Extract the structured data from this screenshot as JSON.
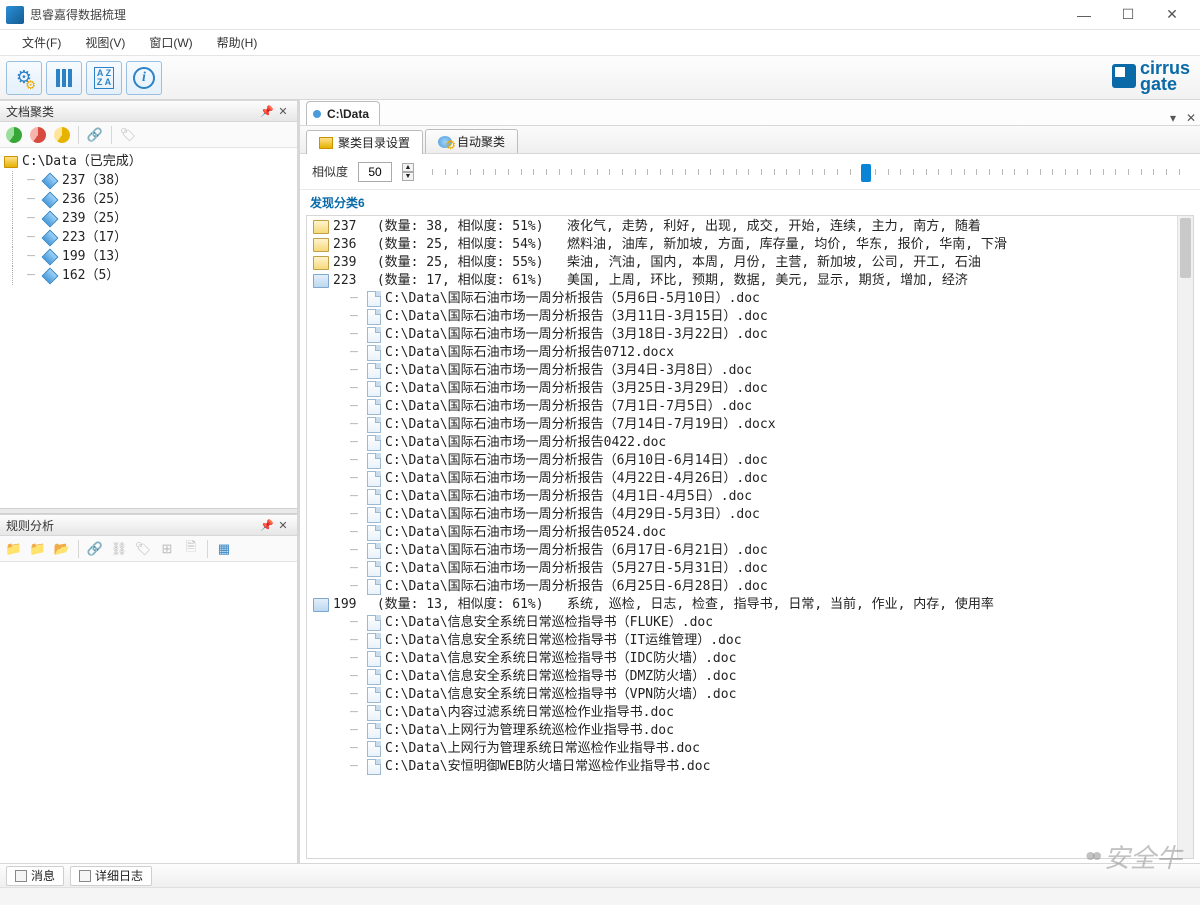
{
  "window": {
    "title": "思睿嘉得数据梳理"
  },
  "menu": {
    "file": "文件(F)",
    "view": "视图(V)",
    "window": "窗口(W)",
    "help": "帮助(H)"
  },
  "brand": {
    "line1": "cirrus",
    "line2": "gate"
  },
  "leftTop": {
    "title": "文档聚类",
    "root": "C:\\Data（已完成）",
    "items": [
      {
        "label": "237（38）"
      },
      {
        "label": "236（25）"
      },
      {
        "label": "239（25）"
      },
      {
        "label": "223（17）"
      },
      {
        "label": "199（13）"
      },
      {
        "label": "162（5）"
      }
    ]
  },
  "leftBottom": {
    "title": "规则分析"
  },
  "docTab": {
    "title": "C:\\Data"
  },
  "subTabs": {
    "a": "聚类目录设置",
    "b": "自动聚类"
  },
  "slider": {
    "label": "相似度",
    "value": "50",
    "pos": 58
  },
  "foundHeader": "发现分类6",
  "categories": [
    {
      "open": false,
      "id": "237",
      "count": "38",
      "sim": "51%",
      "kw": "液化气, 走势, 利好, 出现, 成交, 开始, 连续, 主力, 南方, 随着"
    },
    {
      "open": false,
      "id": "236",
      "count": "25",
      "sim": "54%",
      "kw": "燃料油, 油库, 新加坡, 方面, 库存量, 均价, 华东, 报价, 华南, 下滑"
    },
    {
      "open": false,
      "id": "239",
      "count": "25",
      "sim": "55%",
      "kw": "柴油, 汽油, 国内, 本周, 月份, 主营, 新加坡, 公司, 开工, 石油"
    },
    {
      "open": true,
      "id": "223",
      "count": "17",
      "sim": "61%",
      "kw": "美国, 上周, 环比, 预期, 数据, 美元, 显示, 期货, 增加, 经济",
      "files": [
        "C:\\Data\\国际石油市场一周分析报告（5月6日-5月10日）.doc",
        "C:\\Data\\国际石油市场一周分析报告（3月11日-3月15日）.doc",
        "C:\\Data\\国际石油市场一周分析报告（3月18日-3月22日）.doc",
        "C:\\Data\\国际石油市场一周分析报告0712.docx",
        "C:\\Data\\国际石油市场一周分析报告（3月4日-3月8日）.doc",
        "C:\\Data\\国际石油市场一周分析报告（3月25日-3月29日）.doc",
        "C:\\Data\\国际石油市场一周分析报告（7月1日-7月5日）.doc",
        "C:\\Data\\国际石油市场一周分析报告（7月14日-7月19日）.docx",
        "C:\\Data\\国际石油市场一周分析报告0422.doc",
        "C:\\Data\\国际石油市场一周分析报告（6月10日-6月14日）.doc",
        "C:\\Data\\国际石油市场一周分析报告（4月22日-4月26日）.doc",
        "C:\\Data\\国际石油市场一周分析报告（4月1日-4月5日）.doc",
        "C:\\Data\\国际石油市场一周分析报告（4月29日-5月3日）.doc",
        "C:\\Data\\国际石油市场一周分析报告0524.doc",
        "C:\\Data\\国际石油市场一周分析报告（6月17日-6月21日）.doc",
        "C:\\Data\\国际石油市场一周分析报告（5月27日-5月31日）.doc",
        "C:\\Data\\国际石油市场一周分析报告（6月25日-6月28日）.doc"
      ]
    },
    {
      "open": true,
      "id": "199",
      "count": "13",
      "sim": "61%",
      "kw": "系统, 巡检, 日志, 检查, 指导书, 日常, 当前, 作业, 内存, 使用率",
      "files": [
        "C:\\Data\\信息安全系统日常巡检指导书（FLUKE）.doc",
        "C:\\Data\\信息安全系统日常巡检指导书（IT运维管理）.doc",
        "C:\\Data\\信息安全系统日常巡检指导书（IDC防火墙）.doc",
        "C:\\Data\\信息安全系统日常巡检指导书（DMZ防火墙）.doc",
        "C:\\Data\\信息安全系统日常巡检指导书（VPN防火墙）.doc",
        "C:\\Data\\内容过滤系统日常巡检作业指导书.doc",
        "C:\\Data\\上网行为管理系统巡检作业指导书.doc",
        "C:\\Data\\上网行为管理系统日常巡检作业指导书.doc",
        "C:\\Data\\安恒明御WEB防火墙日常巡检作业指导书.doc"
      ]
    }
  ],
  "bottomTabs": {
    "a": "消息",
    "b": "详细日志"
  },
  "watermark": "安全牛"
}
